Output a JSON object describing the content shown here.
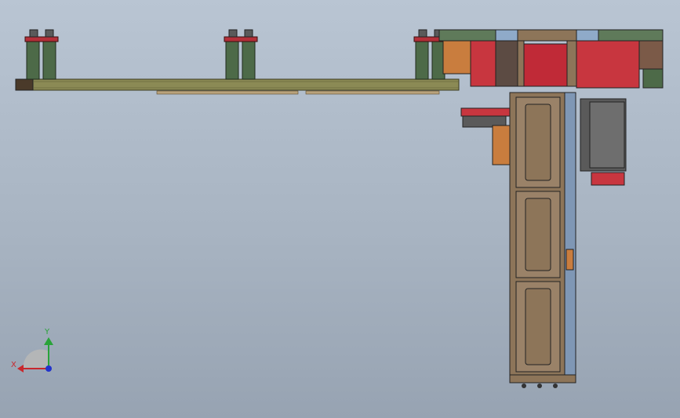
{
  "viewport": {
    "background_top": "#b9c5d3",
    "background_bottom": "#97a3b2"
  },
  "triad": {
    "x_label": "X",
    "y_label": "Y",
    "x_color": "#c8282d",
    "y_color": "#2aa33a",
    "z_color": "#2233cc"
  },
  "colors": {
    "beam": "#8b8a55",
    "post": "#4d6a48",
    "red": "#c8363f",
    "wood": "#8d7559",
    "cabinet_face": "#9a8268",
    "blue_plate": "#7f97b5"
  }
}
